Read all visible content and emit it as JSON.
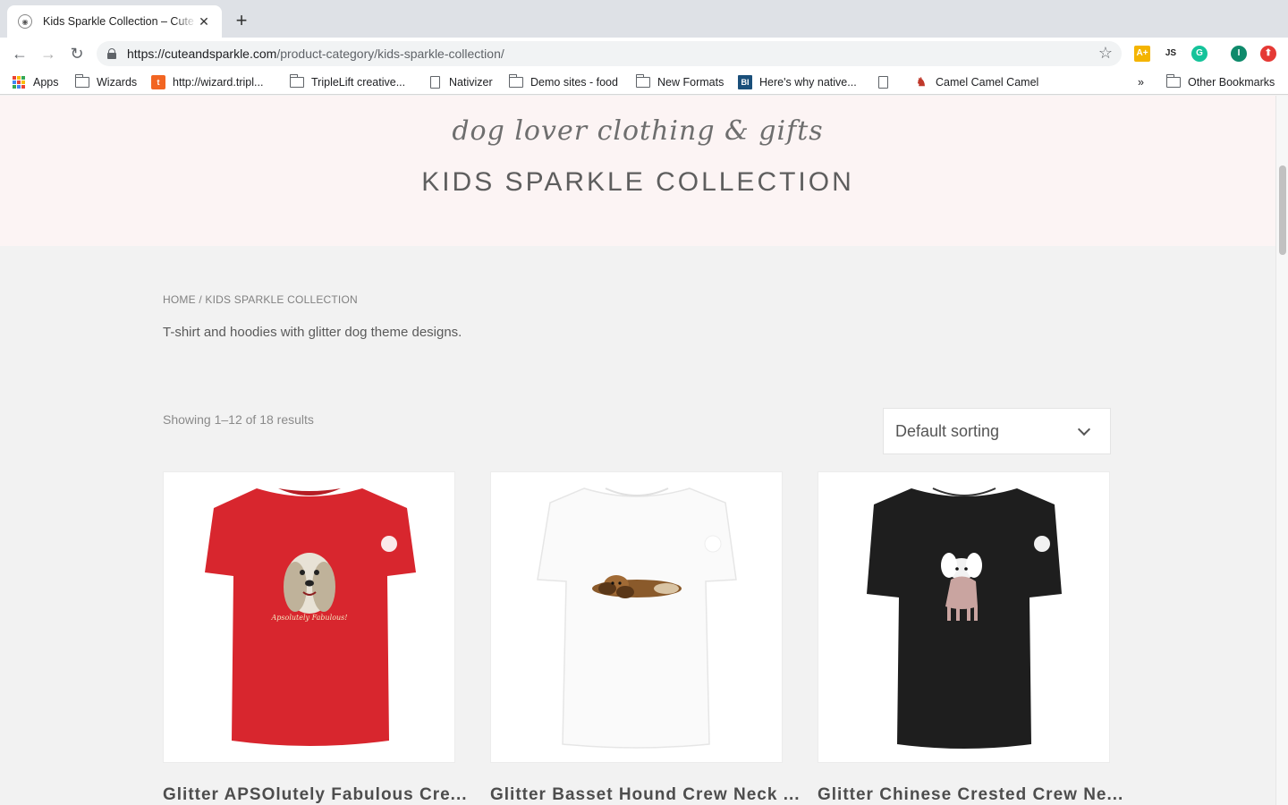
{
  "browser": {
    "tab_title": "Kids Sparkle Collection – Cute and Sparkle",
    "url_host": "https://cuteandsparkle.com",
    "url_path": "/product-category/kids-sparkle-collection/",
    "bookmarks": [
      {
        "label": "Apps",
        "icon": "apps-icon"
      },
      {
        "label": "Wizards",
        "icon": "folder-icon"
      },
      {
        "label": "http://wizard.tripl...",
        "icon": "orange-logo-icon"
      },
      {
        "label": "TripleLift creative...",
        "icon": "folder-icon"
      },
      {
        "label": "Nativizer",
        "icon": "page-icon"
      },
      {
        "label": "Demo sites - food",
        "icon": "folder-icon"
      },
      {
        "label": "New Formats",
        "icon": "folder-icon"
      },
      {
        "label": "Here's why native...",
        "icon": "bi-logo-icon"
      },
      {
        "label": "",
        "icon": "page-icon"
      },
      {
        "label": "Camel Camel Camel",
        "icon": "camel-icon"
      },
      {
        "label": "»",
        "icon": "overflow-icon"
      },
      {
        "label": "Other Bookmarks",
        "icon": "folder-icon"
      }
    ]
  },
  "hero": {
    "logo_text": "dog lover clothing & gifts",
    "title": "KIDS SPARKLE COLLECTION"
  },
  "breadcrumb": {
    "home": "HOME",
    "separator": " / ",
    "current": "KIDS SPARKLE COLLECTION"
  },
  "category_description": "T-shirt and hoodies with glitter dog theme designs.",
  "result_count": "Showing 1–12 of 18 results",
  "sort": {
    "selected": "Default sorting"
  },
  "products": [
    {
      "name": "Glitter APSOlutely Fabulous Cre...",
      "shirt_color": "#d8262e",
      "print_text": "Apsolutely Fabulous!"
    },
    {
      "name": "Glitter Basset Hound Crew Neck ...",
      "shirt_color": "#fafafa",
      "print_text": ""
    },
    {
      "name": "Glitter Chinese Crested Crew Ne...",
      "shirt_color": "#1e1e1e",
      "print_text": ""
    }
  ]
}
